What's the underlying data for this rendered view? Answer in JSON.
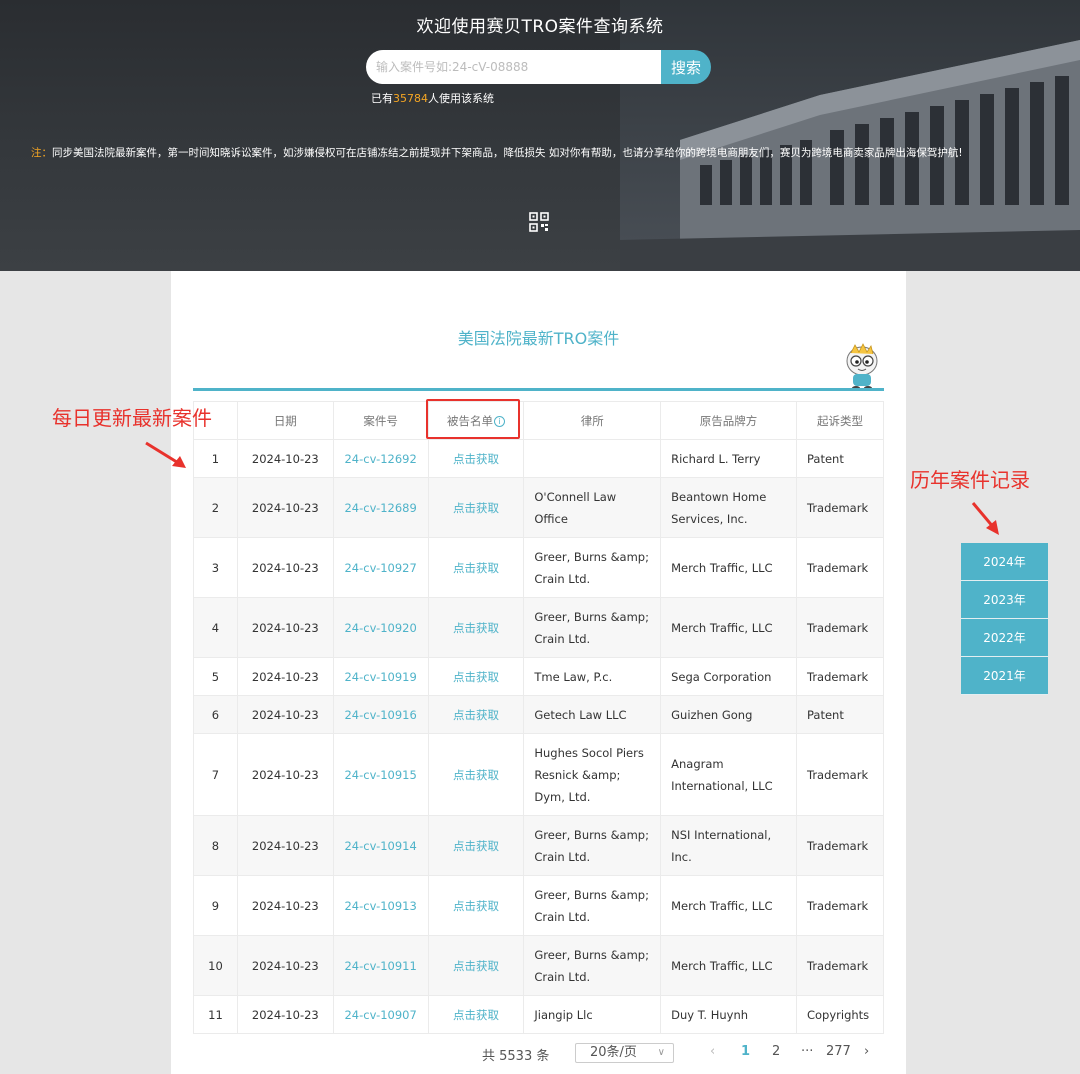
{
  "hero": {
    "title": "欢迎使用赛贝TRO案件查询系统",
    "search_placeholder": "输入案件号如:24-cV-08888",
    "search_button": "搜索",
    "usage_prefix": "已有",
    "usage_count": "35784",
    "usage_suffix": "人使用该系统",
    "notice_label": "注：",
    "notice_text": "同步美国法院最新案件，第一时间知晓诉讼案件，如涉嫌侵权可在店铺冻结之前提现并下架商品，降低损失 如对你有帮助，也请分享给你的跨境电商朋友们，赛贝为跨境电商卖家品牌出海保驾护航!"
  },
  "panel": {
    "title": "美国法院最新TRO案件"
  },
  "table": {
    "headers": {
      "date": "日期",
      "case": "案件号",
      "defendant": "被告名单",
      "law": "律所",
      "brand": "原告品牌方",
      "type": "起诉类型"
    },
    "info_glyph": "i",
    "rows": [
      {
        "idx": "1",
        "date": "2024-10-23",
        "case": "24-cv-12692",
        "def": "点击获取",
        "law": "",
        "brand": "Richard L. Terry",
        "type": "Patent"
      },
      {
        "idx": "2",
        "date": "2024-10-23",
        "case": "24-cv-12689",
        "def": "点击获取",
        "law": "O'Connell Law Office",
        "brand": "Beantown Home Services, Inc.",
        "type": "Trademark"
      },
      {
        "idx": "3",
        "date": "2024-10-23",
        "case": "24-cv-10927",
        "def": "点击获取",
        "law": "Greer, Burns &amp; Crain Ltd.",
        "brand": "Merch Traffic, LLC",
        "type": "Trademark"
      },
      {
        "idx": "4",
        "date": "2024-10-23",
        "case": "24-cv-10920",
        "def": "点击获取",
        "law": "Greer, Burns &amp; Crain Ltd.",
        "brand": "Merch Traffic, LLC",
        "type": "Trademark"
      },
      {
        "idx": "5",
        "date": "2024-10-23",
        "case": "24-cv-10919",
        "def": "点击获取",
        "law": "Tme Law, P.c.",
        "brand": "Sega Corporation",
        "type": "Trademark"
      },
      {
        "idx": "6",
        "date": "2024-10-23",
        "case": "24-cv-10916",
        "def": "点击获取",
        "law": "Getech Law LLC",
        "brand": "Guizhen Gong",
        "type": "Patent"
      },
      {
        "idx": "7",
        "date": "2024-10-23",
        "case": "24-cv-10915",
        "def": "点击获取",
        "law": "Hughes Socol Piers Resnick &amp; Dym, Ltd.",
        "brand": "Anagram International, LLC",
        "type": "Trademark"
      },
      {
        "idx": "8",
        "date": "2024-10-23",
        "case": "24-cv-10914",
        "def": "点击获取",
        "law": "Greer, Burns &amp; Crain Ltd.",
        "brand": "NSI International, Inc.",
        "type": "Trademark"
      },
      {
        "idx": "9",
        "date": "2024-10-23",
        "case": "24-cv-10913",
        "def": "点击获取",
        "law": "Greer, Burns &amp; Crain Ltd.",
        "brand": "Merch Traffic, LLC",
        "type": "Trademark"
      },
      {
        "idx": "10",
        "date": "2024-10-23",
        "case": "24-cv-10911",
        "def": "点击获取",
        "law": "Greer, Burns &amp; Crain Ltd.",
        "brand": "Merch Traffic, LLC",
        "type": "Trademark"
      },
      {
        "idx": "11",
        "date": "2024-10-23",
        "case": "24-cv-10907",
        "def": "点击获取",
        "law": "Jiangip Llc",
        "brand": "Duy T. Huynh",
        "type": "Copyrights"
      }
    ]
  },
  "pager": {
    "total": "共 5533 条",
    "page_size": "20条/页",
    "prev": "‹",
    "page1": "1",
    "page2": "2",
    "dots": "···",
    "last": "277",
    "next": "›"
  },
  "annotations": {
    "left": "每日更新最新案件",
    "right": "历年案件记录"
  },
  "years": [
    "2024年",
    "2023年",
    "2022年",
    "2021年"
  ],
  "colors": {
    "accent": "#4fb3c9",
    "highlight_red": "#e8322c",
    "usage_number": "#f5a623"
  }
}
